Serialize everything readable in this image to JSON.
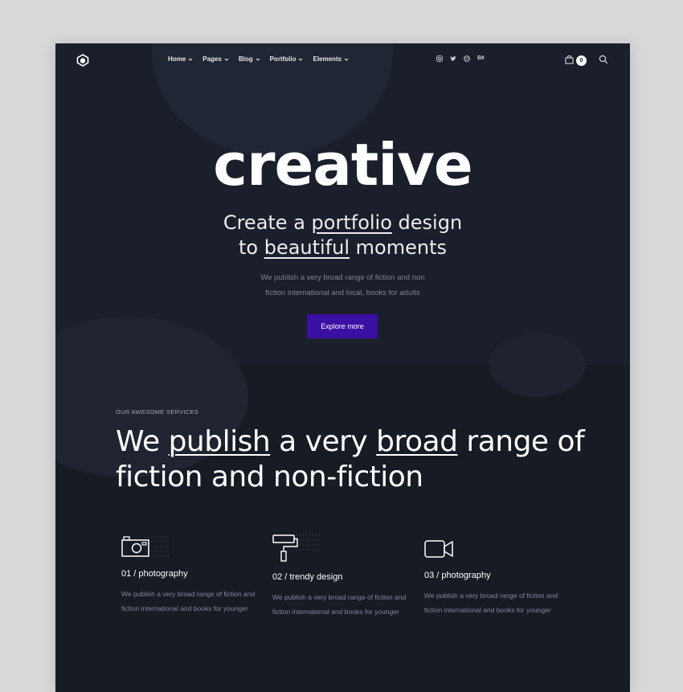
{
  "nav": {
    "menu": [
      {
        "label": "Home"
      },
      {
        "label": "Pages"
      },
      {
        "label": "Blog"
      },
      {
        "label": "Portfolio"
      },
      {
        "label": "Elements"
      }
    ],
    "social": [
      "instagram-icon",
      "twitter-icon",
      "dribbble-icon",
      "behance-icon"
    ],
    "social_behance_text": "Bē",
    "cart_count": "0"
  },
  "hero": {
    "word": "creative",
    "sub_line1_pre": "Create a ",
    "sub_line1_u": "portfolio",
    "sub_line1_post": " design",
    "sub_line2_pre": "to ",
    "sub_line2_u": "beautiful",
    "sub_line2_post": " moments",
    "text_line1": "We publish a very broad range of fiction and non",
    "text_line2": "fiction international and local, books for adults",
    "cta_label": "Explore more"
  },
  "services": {
    "eyebrow": "OUR AWESOME SERVICES",
    "headline_pre": "We ",
    "headline_u1": "publish",
    "headline_mid": " a very ",
    "headline_u2": "broad",
    "headline_post1": " range of",
    "headline_line2": "fiction and non-fiction",
    "items": [
      {
        "title": "01 / photography",
        "desc_line1": "We publish a very broad range of fiction and",
        "desc_line2": "fiction international and books for younger"
      },
      {
        "title": "02 / trendy design",
        "desc_line1": "We publish a very broad range of fiction and",
        "desc_line2": "fiction international and books for younger"
      },
      {
        "title": "03 / photography",
        "desc_line1": "We publish a very broad range of fiction and",
        "desc_line2": "fiction international and books for younger"
      }
    ]
  },
  "colors": {
    "background": "#171b24",
    "accent": "#3a0fa3",
    "text": "#ffffff"
  }
}
